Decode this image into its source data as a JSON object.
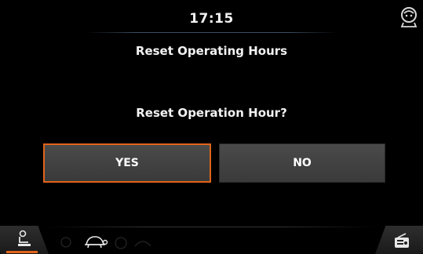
{
  "header": {
    "time": "17:15",
    "title": "Reset Operating Hours"
  },
  "dialog": {
    "question": "Reset Operation Hour?",
    "yes_label": "YES",
    "no_label": "NO",
    "selected": "YES"
  },
  "icons": {
    "corner": "operator-face-icon",
    "bottom_left_active": "operator-seat-icon",
    "bottom_middle": "turtle-icon",
    "bottom_middle_faint": "speed-mode-icons",
    "bottom_right": "radio-icon"
  },
  "colors": {
    "background": "#000000",
    "accent": "#e0641a",
    "button": "#404040",
    "text": "#f2f2f2"
  }
}
